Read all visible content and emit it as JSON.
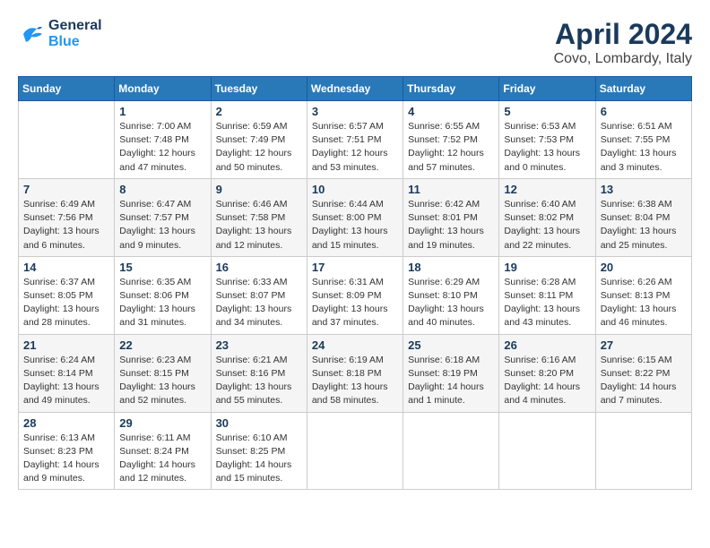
{
  "logo": {
    "line1": "General",
    "line2": "Blue"
  },
  "title": "April 2024",
  "subtitle": "Covo, Lombardy, Italy",
  "weekdays": [
    "Sunday",
    "Monday",
    "Tuesday",
    "Wednesday",
    "Thursday",
    "Friday",
    "Saturday"
  ],
  "weeks": [
    [
      {
        "day": "",
        "info": ""
      },
      {
        "day": "1",
        "info": "Sunrise: 7:00 AM\nSunset: 7:48 PM\nDaylight: 12 hours\nand 47 minutes."
      },
      {
        "day": "2",
        "info": "Sunrise: 6:59 AM\nSunset: 7:49 PM\nDaylight: 12 hours\nand 50 minutes."
      },
      {
        "day": "3",
        "info": "Sunrise: 6:57 AM\nSunset: 7:51 PM\nDaylight: 12 hours\nand 53 minutes."
      },
      {
        "day": "4",
        "info": "Sunrise: 6:55 AM\nSunset: 7:52 PM\nDaylight: 12 hours\nand 57 minutes."
      },
      {
        "day": "5",
        "info": "Sunrise: 6:53 AM\nSunset: 7:53 PM\nDaylight: 13 hours\nand 0 minutes."
      },
      {
        "day": "6",
        "info": "Sunrise: 6:51 AM\nSunset: 7:55 PM\nDaylight: 13 hours\nand 3 minutes."
      }
    ],
    [
      {
        "day": "7",
        "info": "Sunrise: 6:49 AM\nSunset: 7:56 PM\nDaylight: 13 hours\nand 6 minutes."
      },
      {
        "day": "8",
        "info": "Sunrise: 6:47 AM\nSunset: 7:57 PM\nDaylight: 13 hours\nand 9 minutes."
      },
      {
        "day": "9",
        "info": "Sunrise: 6:46 AM\nSunset: 7:58 PM\nDaylight: 13 hours\nand 12 minutes."
      },
      {
        "day": "10",
        "info": "Sunrise: 6:44 AM\nSunset: 8:00 PM\nDaylight: 13 hours\nand 15 minutes."
      },
      {
        "day": "11",
        "info": "Sunrise: 6:42 AM\nSunset: 8:01 PM\nDaylight: 13 hours\nand 19 minutes."
      },
      {
        "day": "12",
        "info": "Sunrise: 6:40 AM\nSunset: 8:02 PM\nDaylight: 13 hours\nand 22 minutes."
      },
      {
        "day": "13",
        "info": "Sunrise: 6:38 AM\nSunset: 8:04 PM\nDaylight: 13 hours\nand 25 minutes."
      }
    ],
    [
      {
        "day": "14",
        "info": "Sunrise: 6:37 AM\nSunset: 8:05 PM\nDaylight: 13 hours\nand 28 minutes."
      },
      {
        "day": "15",
        "info": "Sunrise: 6:35 AM\nSunset: 8:06 PM\nDaylight: 13 hours\nand 31 minutes."
      },
      {
        "day": "16",
        "info": "Sunrise: 6:33 AM\nSunset: 8:07 PM\nDaylight: 13 hours\nand 34 minutes."
      },
      {
        "day": "17",
        "info": "Sunrise: 6:31 AM\nSunset: 8:09 PM\nDaylight: 13 hours\nand 37 minutes."
      },
      {
        "day": "18",
        "info": "Sunrise: 6:29 AM\nSunset: 8:10 PM\nDaylight: 13 hours\nand 40 minutes."
      },
      {
        "day": "19",
        "info": "Sunrise: 6:28 AM\nSunset: 8:11 PM\nDaylight: 13 hours\nand 43 minutes."
      },
      {
        "day": "20",
        "info": "Sunrise: 6:26 AM\nSunset: 8:13 PM\nDaylight: 13 hours\nand 46 minutes."
      }
    ],
    [
      {
        "day": "21",
        "info": "Sunrise: 6:24 AM\nSunset: 8:14 PM\nDaylight: 13 hours\nand 49 minutes."
      },
      {
        "day": "22",
        "info": "Sunrise: 6:23 AM\nSunset: 8:15 PM\nDaylight: 13 hours\nand 52 minutes."
      },
      {
        "day": "23",
        "info": "Sunrise: 6:21 AM\nSunset: 8:16 PM\nDaylight: 13 hours\nand 55 minutes."
      },
      {
        "day": "24",
        "info": "Sunrise: 6:19 AM\nSunset: 8:18 PM\nDaylight: 13 hours\nand 58 minutes."
      },
      {
        "day": "25",
        "info": "Sunrise: 6:18 AM\nSunset: 8:19 PM\nDaylight: 14 hours\nand 1 minute."
      },
      {
        "day": "26",
        "info": "Sunrise: 6:16 AM\nSunset: 8:20 PM\nDaylight: 14 hours\nand 4 minutes."
      },
      {
        "day": "27",
        "info": "Sunrise: 6:15 AM\nSunset: 8:22 PM\nDaylight: 14 hours\nand 7 minutes."
      }
    ],
    [
      {
        "day": "28",
        "info": "Sunrise: 6:13 AM\nSunset: 8:23 PM\nDaylight: 14 hours\nand 9 minutes."
      },
      {
        "day": "29",
        "info": "Sunrise: 6:11 AM\nSunset: 8:24 PM\nDaylight: 14 hours\nand 12 minutes."
      },
      {
        "day": "30",
        "info": "Sunrise: 6:10 AM\nSunset: 8:25 PM\nDaylight: 14 hours\nand 15 minutes."
      },
      {
        "day": "",
        "info": ""
      },
      {
        "day": "",
        "info": ""
      },
      {
        "day": "",
        "info": ""
      },
      {
        "day": "",
        "info": ""
      }
    ]
  ]
}
